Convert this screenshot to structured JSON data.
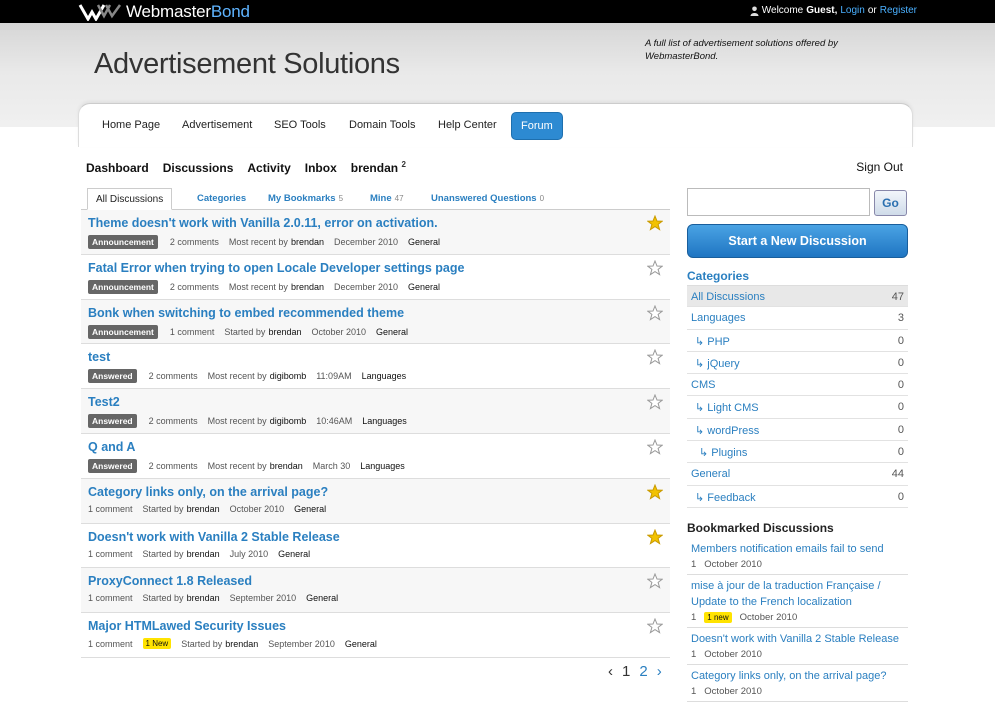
{
  "topbar": {
    "logo_text_a": "Webmaster",
    "logo_text_b": "Bond",
    "welcome": "Welcome",
    "guest": "Guest,",
    "login": "Login",
    "or": "or",
    "register": "Register"
  },
  "banner": {
    "title": "Advertisement Solutions",
    "tagline": "A full list of advertisement solutions offered by WebmasterBond."
  },
  "nav": {
    "items": [
      "Home Page",
      "Advertisement",
      "SEO Tools",
      "Domain Tools",
      "Help Center",
      "Forum"
    ]
  },
  "userbar": {
    "dashboard": "Dashboard",
    "discussions": "Discussions",
    "activity": "Activity",
    "inbox": "Inbox",
    "user": "brendan",
    "notifications": "2",
    "sign_out": "Sign Out"
  },
  "tabs": [
    {
      "label": "All Discussions",
      "count": ""
    },
    {
      "label": "Categories",
      "count": ""
    },
    {
      "label": "My Bookmarks",
      "count": "5"
    },
    {
      "label": "Mine",
      "count": "47"
    },
    {
      "label": "Unanswered Questions",
      "count": "0"
    }
  ],
  "discussions": [
    {
      "title": "Theme doesn't work with Vanilla 2.0.11, error on activation.",
      "badge": "Announcement",
      "comments": "2 comments",
      "recent": "Most recent by",
      "author": "brendan",
      "date": "December 2010",
      "category": "General",
      "starred": true,
      "new": ""
    },
    {
      "title": "Fatal Error when trying to open Locale Developer settings page",
      "badge": "Announcement",
      "comments": "2 comments",
      "recent": "Most recent by",
      "author": "brendan",
      "date": "December 2010",
      "category": "General",
      "starred": false,
      "new": ""
    },
    {
      "title": "Bonk when switching to embed recommended theme",
      "badge": "Announcement",
      "comments": "1 comment",
      "recent": "Started by",
      "author": "brendan",
      "date": "October 2010",
      "category": "General",
      "starred": false,
      "new": ""
    },
    {
      "title": "test",
      "badge": "Answered",
      "comments": "2 comments",
      "recent": "Most recent by",
      "author": "digibomb",
      "date": "11:09AM",
      "category": "Languages",
      "starred": false,
      "new": ""
    },
    {
      "title": "Test2",
      "badge": "Answered",
      "comments": "2 comments",
      "recent": "Most recent by",
      "author": "digibomb",
      "date": "10:46AM",
      "category": "Languages",
      "starred": false,
      "new": ""
    },
    {
      "title": "Q and A",
      "badge": "Answered",
      "comments": "2 comments",
      "recent": "Most recent by",
      "author": "brendan",
      "date": "March 30",
      "category": "Languages",
      "starred": false,
      "new": ""
    },
    {
      "title": "Category links only, on the arrival page?",
      "badge": "",
      "comments": "1 comment",
      "recent": "Started by",
      "author": "brendan",
      "date": "October 2010",
      "category": "General",
      "starred": true,
      "new": ""
    },
    {
      "title": "Doesn't work with Vanilla 2 Stable Release",
      "badge": "",
      "comments": "1 comment",
      "recent": "Started by",
      "author": "brendan",
      "date": "July 2010",
      "category": "General",
      "starred": true,
      "new": ""
    },
    {
      "title": "ProxyConnect 1.8 Released",
      "badge": "",
      "comments": "1 comment",
      "recent": "Started by",
      "author": "brendan",
      "date": "September 2010",
      "category": "General",
      "starred": false,
      "new": ""
    },
    {
      "title": "Major HTMLawed Security Issues",
      "badge": "",
      "comments": "1 comment",
      "recent": "Started by",
      "author": "brendan",
      "date": "September 2010",
      "category": "General",
      "starred": false,
      "new": "1 New"
    }
  ],
  "pager": {
    "prev": "‹",
    "page1": "1",
    "page2": "2",
    "next": "›"
  },
  "sidebar": {
    "search_placeholder": "",
    "go": "Go",
    "new_discussion": "Start a New Discussion",
    "categories_heading": "Categories",
    "categories": [
      {
        "name": "All Discussions",
        "count": "47",
        "level": 0
      },
      {
        "name": "Languages",
        "count": "3",
        "level": 0
      },
      {
        "name": "↳ PHP",
        "count": "0",
        "level": 1
      },
      {
        "name": "↳ jQuery",
        "count": "0",
        "level": 1
      },
      {
        "name": "CMS",
        "count": "0",
        "level": 0
      },
      {
        "name": "↳ Light CMS",
        "count": "0",
        "level": 1
      },
      {
        "name": "↳ wordPress",
        "count": "0",
        "level": 1
      },
      {
        "name": "↳ Plugins",
        "count": "0",
        "level": 2
      },
      {
        "name": "General",
        "count": "44",
        "level": 0
      },
      {
        "name": "↳ Feedback",
        "count": "0",
        "level": 1
      }
    ],
    "bookmarks_heading": "Bookmarked Discussions",
    "bookmarks": [
      {
        "title": "Members notification emails fail to send",
        "count": "1",
        "new": "",
        "date": "October 2010"
      },
      {
        "title": "mise à jour de la traduction Française / Update to the French localization",
        "count": "1",
        "new": "1 new",
        "date": "October 2010"
      },
      {
        "title": "Doesn't work with Vanilla 2 Stable Release",
        "count": "1",
        "new": "",
        "date": "October 2010"
      },
      {
        "title": "Category links only, on the arrival page?",
        "count": "1",
        "new": "",
        "date": "October 2010"
      }
    ]
  },
  "colors": {
    "link": "#2a7fc0",
    "badge": "#666666",
    "new": "#ffe300",
    "star": "#f2c200",
    "button": "#2d8ad2"
  }
}
